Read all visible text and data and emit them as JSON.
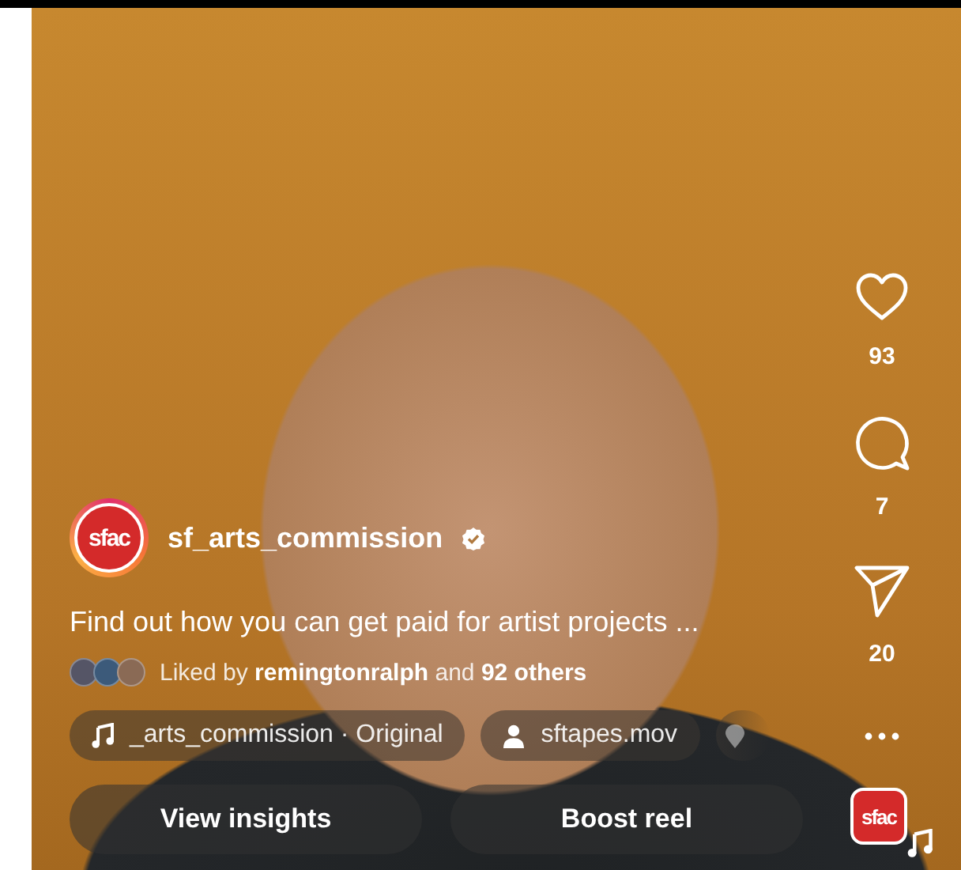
{
  "post": {
    "account": {
      "avatar_text": "sfac",
      "username": "sf_arts_commission",
      "verified": true
    },
    "caption": "Find out how you can get paid for artist projects ...",
    "liked_by": "Liked by **remingtonralph** and **92 others**"
  },
  "actions": [
    {
      "kind": "like",
      "count": "93"
    },
    {
      "kind": "comment",
      "count": "7"
    },
    {
      "kind": "share",
      "count": "20"
    }
  ],
  "chips": [
    {
      "kind": "audio",
      "label": "_arts_commission · Original"
    },
    {
      "kind": "person",
      "label": "sftapes.mov"
    },
    {
      "kind": "location"
    }
  ],
  "buttons": [
    "View insights",
    "Boost reel"
  ],
  "audio_avatar_text": "sfac"
}
